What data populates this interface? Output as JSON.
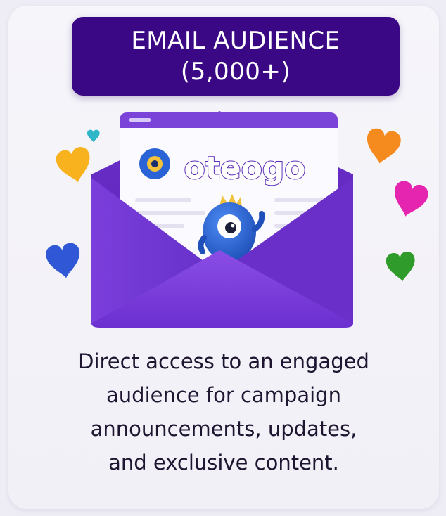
{
  "card": {
    "title_line1": "EMAIL AUDIENCE",
    "title_line2": "(5,000+)",
    "brand_name": "oteogo",
    "description_lines": [
      "Direct access to an engaged",
      "audience for campaign",
      "announcements, updates,",
      "and exclusive content."
    ]
  },
  "colors": {
    "banner": "#3a0785",
    "envelope": "#7a3fd6",
    "text": "#1e1530"
  },
  "icons": {
    "hearts": [
      "cyan-heart-icon",
      "yellow-heart-icon",
      "blue-heart-icon",
      "orange-heart-icon",
      "pink-heart-icon",
      "green-heart-icon"
    ],
    "mascot": "blue-monster-mascot-icon",
    "envelope": "open-envelope-icon"
  }
}
